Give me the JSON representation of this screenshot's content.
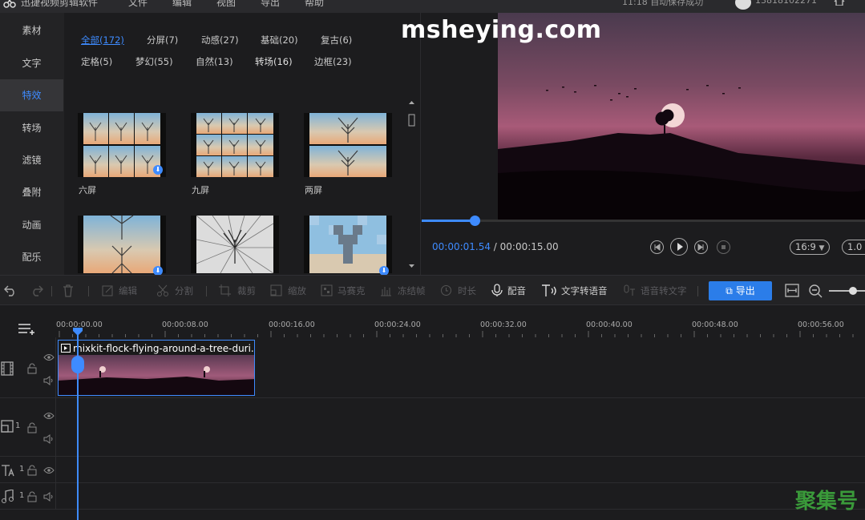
{
  "menubar": {
    "app_name": "迅捷视频剪辑软件",
    "menus": [
      "文件",
      "编辑",
      "视图",
      "导出",
      "帮助"
    ],
    "save_status": "11:18 自动保存成功",
    "user": "13818102271"
  },
  "sidebar": {
    "items": [
      {
        "label": "素材"
      },
      {
        "label": "文字"
      },
      {
        "label": "特效",
        "active": true
      },
      {
        "label": "转场"
      },
      {
        "label": "滤镜"
      },
      {
        "label": "叠附"
      },
      {
        "label": "动画"
      },
      {
        "label": "配乐"
      }
    ]
  },
  "effects": {
    "tabs_row1": [
      "全部(172)",
      "分屏(7)",
      "动感(27)",
      "基础(20)",
      "复古(6)"
    ],
    "tabs_row2": [
      "定格(5)",
      "梦幻(55)",
      "自然(13)",
      "转场(16)",
      "边框(23)"
    ],
    "thumbs": [
      "六屏",
      "九屏",
      "两屏",
      "",
      "",
      ""
    ]
  },
  "preview": {
    "watermark": "msheying.com",
    "current_time": "00:00:01.54",
    "separator": " / ",
    "total_time": "00:00:15.00",
    "progress": 0.12,
    "ratio": "16:9",
    "ratio2": "1.0"
  },
  "toolbar": {
    "edit": "编辑",
    "split": "分割",
    "crop": "裁剪",
    "zoom": "缩放",
    "mosaic": "马赛克",
    "freeze": "冻结帧",
    "duration": "时长",
    "dub": "配音",
    "tts": "文字转语音",
    "stt": "语音转文字",
    "export": "导出"
  },
  "timeline": {
    "ticks": [
      "00:00:00.00",
      "00:00:08.00",
      "00:00:16.00",
      "00:00:24.00",
      "00:00:32.00",
      "00:00:40.00",
      "00:00:48.00",
      "00:00:56.00"
    ],
    "clip_title": "mixkit-flock-flying-around-a-tree-duri...",
    "track_nums": [
      "1",
      "1",
      "1"
    ]
  },
  "brand": "聚集号",
  "colors": {
    "accent": "#3e8bff",
    "export": "#2b7de9",
    "brand": "#3a9a3a"
  }
}
